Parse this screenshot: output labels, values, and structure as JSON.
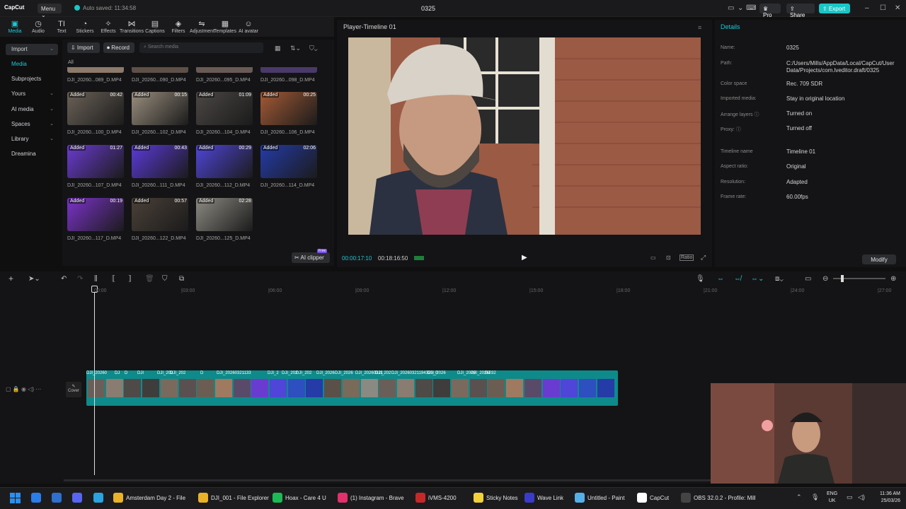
{
  "topbar": {
    "logo": "CapCut",
    "menu": "Menu ⌄",
    "autosave": "Auto saved: 11:34:58",
    "project": "0325",
    "pro": "♛ Pro",
    "share": "⇪ Share",
    "export": "⇪ Export"
  },
  "toolbar": [
    {
      "label": "Media",
      "icon": "▣",
      "active": true
    },
    {
      "label": "Audio",
      "icon": "◷"
    },
    {
      "label": "Text",
      "icon": "TI"
    },
    {
      "label": "Stickers",
      "icon": "◔"
    },
    {
      "label": "Effects",
      "icon": "✧"
    },
    {
      "label": "Transitions",
      "icon": "⋈"
    },
    {
      "label": "Captions",
      "icon": "▤"
    },
    {
      "label": "Filters",
      "icon": "◈"
    },
    {
      "label": "Adjustment",
      "icon": "⇋"
    },
    {
      "label": "Templates",
      "icon": "▦"
    },
    {
      "label": "AI avatar",
      "icon": "☺"
    }
  ],
  "sidenav": [
    {
      "label": "Import",
      "sel": true
    },
    {
      "label": "Media"
    },
    {
      "label": "Subprojects"
    },
    {
      "label": "Yours",
      "chev": true
    },
    {
      "label": "AI media",
      "chev": true
    },
    {
      "label": "Spaces",
      "chev": true
    },
    {
      "label": "Library",
      "chev": true
    },
    {
      "label": "Dreamina"
    }
  ],
  "media": {
    "import": "⇩ Import",
    "record": "⏺ Record",
    "search_placeholder": "Search media",
    "filter_all": "All",
    "ai_clipper": "AI clipper",
    "free": "Free",
    "top_names": [
      "DJI_20260...089_D.MP4",
      "DJI_20260...090_D.MP4",
      "DJI_20260...095_D.MP4",
      "DJI_20260...098_D.MP4"
    ],
    "items": [
      {
        "name": "DJI_20260...100_D.MP4",
        "dur": "00:42",
        "added": "Added",
        "color": "#6b6258"
      },
      {
        "name": "DJI_20260...102_D.MP4",
        "dur": "00:15",
        "added": "Added",
        "color": "#9a8e7e"
      },
      {
        "name": "DJI_20260...104_D.MP4",
        "dur": "01:09",
        "added": "Added",
        "color": "#4b4744"
      },
      {
        "name": "DJI_20260...106_D.MP4",
        "dur": "00:25",
        "added": "Added",
        "color": "#a45a35"
      },
      {
        "name": "DJI_20260...107_D.MP4",
        "dur": "01:27",
        "added": "Added",
        "color": "#6a3bd0"
      },
      {
        "name": "DJI_20260...111_D.MP4",
        "dur": "00:43",
        "added": "Added",
        "color": "#5b3ad9"
      },
      {
        "name": "DJI_20260...112_D.MP4",
        "dur": "00:29",
        "added": "Added",
        "color": "#4f45d8"
      },
      {
        "name": "DJI_20260...114_D.MP4",
        "dur": "02:06",
        "added": "Added",
        "color": "#243ba8"
      },
      {
        "name": "DJI_20260...117_D.MP4",
        "dur": "00:19",
        "added": "Added",
        "color": "#7b33c9"
      },
      {
        "name": "DJI_20260...122_D.MP4",
        "dur": "00:57",
        "added": "Added",
        "color": "#4a4038"
      },
      {
        "name": "DJI_20260...125_D.MP4",
        "dur": "02:28",
        "added": "Added",
        "color": "#8c8a82"
      }
    ]
  },
  "player": {
    "title": "Player-Timeline 01",
    "timecode": "00:00:17:10",
    "duration": "00:18:16:50",
    "ratio": "Ratio"
  },
  "details": {
    "title": "Details",
    "modify": "Modify",
    "rows": [
      {
        "k": "Name:",
        "v": "0325"
      },
      {
        "k": "Path:",
        "v": "C:/Users/Mills/AppData/Local/CapCut/User Data/Projects/com.lveditor.draft/0325"
      },
      {
        "k": "Color space",
        "v": "Rec. 709 SDR"
      },
      {
        "k": "Imported media:",
        "v": "Stay in original location"
      },
      {
        "k": "Arrange layers ⓘ",
        "v": "Turned on"
      },
      {
        "k": "Proxy: ⓘ",
        "v": "Turned off"
      },
      {
        "k": "Timeline name",
        "v": "Timeline 01"
      },
      {
        "k": "Aspect ratio:",
        "v": "Original"
      },
      {
        "k": "Resolution:",
        "v": "Adapted"
      },
      {
        "k": "Frame rate:",
        "v": "60.00fps"
      }
    ]
  },
  "timeline": {
    "ruler": [
      "00:00",
      "|03:00",
      "|06:00",
      "|09:00",
      "|12:00",
      "|15:00",
      "|18:00",
      "|21:00",
      "|24:00",
      "|27:00"
    ],
    "cover": "Cover",
    "clips": [
      "DJI_20260",
      "DJ",
      "D",
      "DJI",
      "DJI_202",
      "DJI_202",
      "D",
      "DJI_20260321133",
      "DJI_2",
      "DJI_202",
      "DJI_202",
      "DJI_2026",
      "DJI_2026",
      "DJI_20260321",
      "DJI_202",
      "DJI_20260321194325_0",
      "DJI_2026",
      "DJI_2026",
      "DJI_2026032",
      "DJ"
    ]
  },
  "taskbar": {
    "items": [
      {
        "label": "",
        "color": "#2b7de9"
      },
      {
        "label": "",
        "color": "#2f6fcf"
      },
      {
        "label": "",
        "color": "#5865f2"
      },
      {
        "label": "",
        "color": "#2aa3e0"
      },
      {
        "label": "Amsterdam Day 2 - File",
        "color": "#e9b227"
      },
      {
        "label": "DJI_001 - File Explorer",
        "color": "#e9b227"
      },
      {
        "label": "Hoax - Care 4 U",
        "color": "#1db954"
      },
      {
        "label": "(1) Instagram - Brave",
        "color": "#e1306c"
      },
      {
        "label": "iVMS-4200",
        "color": "#c62828"
      },
      {
        "label": "Sticky Notes",
        "color": "#f2d13a"
      },
      {
        "label": "Wave Link",
        "color": "#3a3cc9"
      },
      {
        "label": "Untitled - Paint",
        "color": "#56b0e8"
      },
      {
        "label": "CapCut",
        "color": "#ffffff"
      },
      {
        "label": "OBS 32.0.2 - Profile: Mill",
        "color": "#444444"
      }
    ],
    "lang1": "ENG",
    "lang2": "UK",
    "time": "11:36 AM",
    "date": "25/03/26"
  }
}
